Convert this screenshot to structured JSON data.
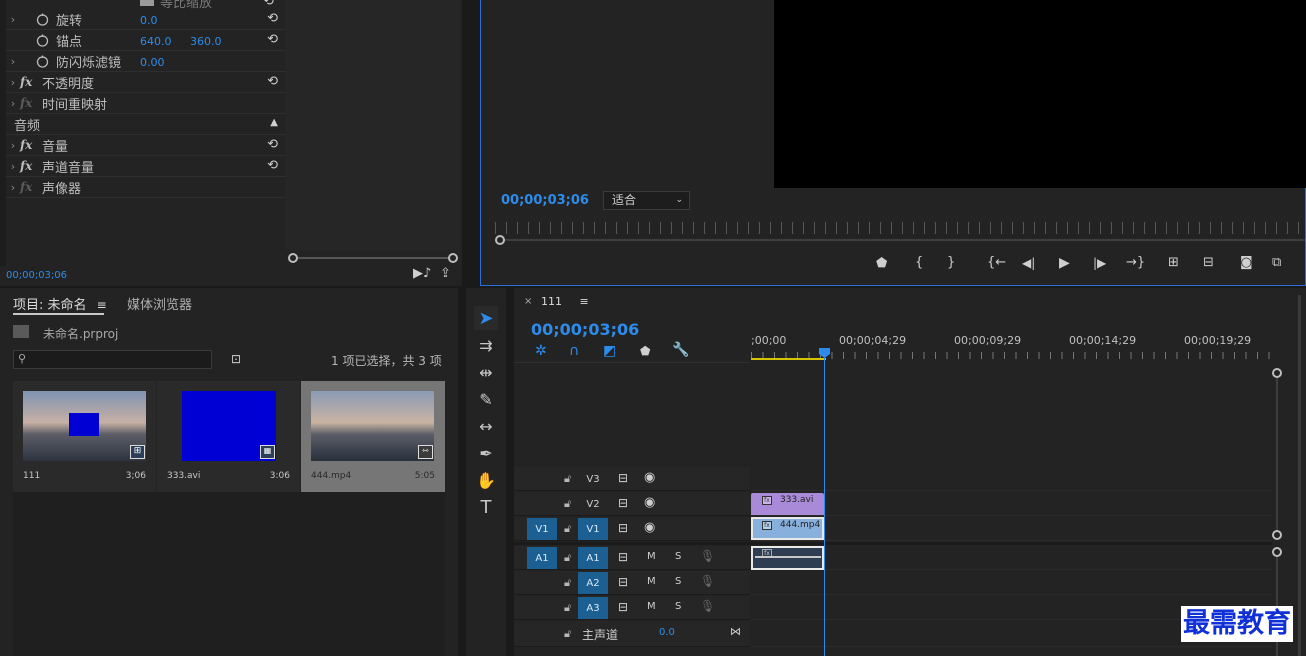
{
  "effect_controls": {
    "top_cut_label": "等比缩放",
    "rows": [
      {
        "label": "旋转",
        "value1": "0.0",
        "value2": ""
      },
      {
        "label": "锚点",
        "value1": "640.0",
        "value2": "360.0"
      },
      {
        "label": "防闪烁滤镜",
        "value1": "0.00",
        "value2": ""
      },
      {
        "label": "不透明度"
      },
      {
        "label": "时间重映射"
      }
    ],
    "audio_header": "音频",
    "audio_rows": [
      {
        "label": "音量"
      },
      {
        "label": "声道音量"
      },
      {
        "label": "声像器"
      }
    ],
    "timecode": "00;00;03;06"
  },
  "program_monitor": {
    "timecode": "00;00;03;06",
    "fit_select": "适合"
  },
  "project": {
    "tabs": [
      {
        "label": "项目: 未命名"
      },
      {
        "label": "媒体浏览器"
      }
    ],
    "file_name": "未命名.prproj",
    "search_placeholder": "",
    "selection_info": "1 项已选择，共 3 项",
    "items": [
      {
        "name": "111",
        "duration": "3;06"
      },
      {
        "name": "333.avi",
        "duration": "3:06"
      },
      {
        "name": "444.mp4",
        "duration": "5:05"
      }
    ]
  },
  "timeline": {
    "sequence_name": "111",
    "timecode": "00;00;03;06",
    "ruler": [
      ";00;00",
      "00;00;04;29",
      "00;00;09;29",
      "00;00;14;29",
      "00;00;19;29"
    ],
    "video_tracks": [
      {
        "src": "",
        "name": "V3"
      },
      {
        "src": "",
        "name": "V2"
      },
      {
        "src": "V1",
        "name": "V1"
      }
    ],
    "audio_tracks": [
      {
        "src": "A1",
        "name": "A1",
        "m": "M",
        "s": "S"
      },
      {
        "src": "",
        "name": "A2",
        "m": "M",
        "s": "S"
      },
      {
        "src": "",
        "name": "A3",
        "m": "M",
        "s": "S"
      }
    ],
    "master": {
      "label": "主声道",
      "value": "0.0"
    },
    "clips": [
      {
        "name": "333.avi"
      },
      {
        "name": "444.mp4"
      }
    ]
  },
  "watermark": "最需教育",
  "colors": {
    "accent": "#2d8ceb",
    "track_on": "#1c5f93",
    "clip_video": "#a98ad8",
    "clip_v1": "#88b0dc"
  }
}
